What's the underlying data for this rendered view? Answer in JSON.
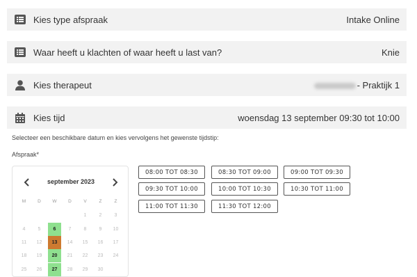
{
  "rows": [
    {
      "label": "Kies type afspraak",
      "value": "Intake Online",
      "icon": "list-icon"
    },
    {
      "label": "Waar heeft u klachten of waar heeft u last van?",
      "value": "Knie",
      "icon": "list-icon"
    },
    {
      "label": "Kies therapeut",
      "value": "- Praktijk 1",
      "icon": "person-icon"
    },
    {
      "label": "Kies tijd",
      "value": "woensdag 13 september 09:30 tot 10:00",
      "icon": "calendar-icon"
    }
  ],
  "help_text": "Selecteer een beschikbare datum en kies vervolgens het gewenste tijdstip:",
  "field_label": "Afspraak*",
  "calendar": {
    "title": "september 2023",
    "prev_icon": "chevron-left-icon",
    "next_icon": "chevron-right-icon",
    "weekdays": [
      "M",
      "D",
      "W",
      "D",
      "V",
      "Z",
      "Z"
    ],
    "weeks": [
      [
        "",
        "",
        "",
        "",
        "1",
        "2",
        "3"
      ],
      [
        "4",
        "5",
        "6",
        "7",
        "8",
        "9",
        "10"
      ],
      [
        "11",
        "12",
        "13",
        "14",
        "15",
        "16",
        "17"
      ],
      [
        "18",
        "19",
        "20",
        "21",
        "22",
        "23",
        "24"
      ],
      [
        "25",
        "26",
        "27",
        "28",
        "29",
        "30",
        ""
      ]
    ],
    "available_days": [
      "6",
      "20",
      "27"
    ],
    "selected_day": "13",
    "available_color": "#8fe08f",
    "selected_color": "#cd7a30"
  },
  "time_slots": [
    [
      "08:00 TOT 08:30",
      "08:30 TOT 09:00",
      "09:00 TOT 09:30"
    ],
    [
      "09:30 TOT 10:00",
      "10:00 TOT 10:30",
      "10:30 TOT 11:00"
    ],
    [
      "11:00 TOT 11:30",
      "11:30 TOT 12:00"
    ]
  ]
}
